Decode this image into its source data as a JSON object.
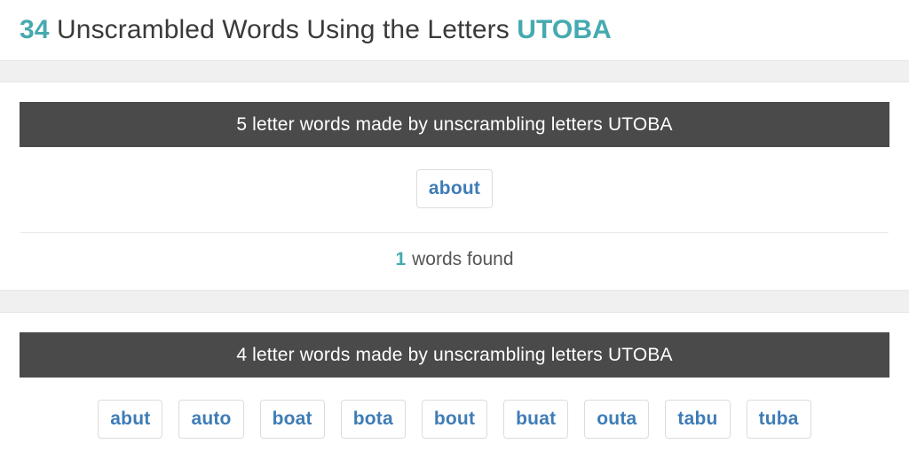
{
  "page": {
    "title_count": "34",
    "title_middle": "Unscrambled Words Using the Letters",
    "title_letters": "UTOBA",
    "accent_color": "#45aab0",
    "chip_text_color": "#3e7cb6",
    "section_bar_color": "#4a4a4a"
  },
  "sections": [
    {
      "heading": "5 letter words made by unscrambling letters UTOBA",
      "words": [
        "about"
      ],
      "count_number": "1",
      "count_label": "words found"
    },
    {
      "heading": "4 letter words made by unscrambling letters UTOBA",
      "words": [
        "abut",
        "auto",
        "boat",
        "bota",
        "bout",
        "buat",
        "outa",
        "tabu",
        "tuba"
      ]
    }
  ]
}
